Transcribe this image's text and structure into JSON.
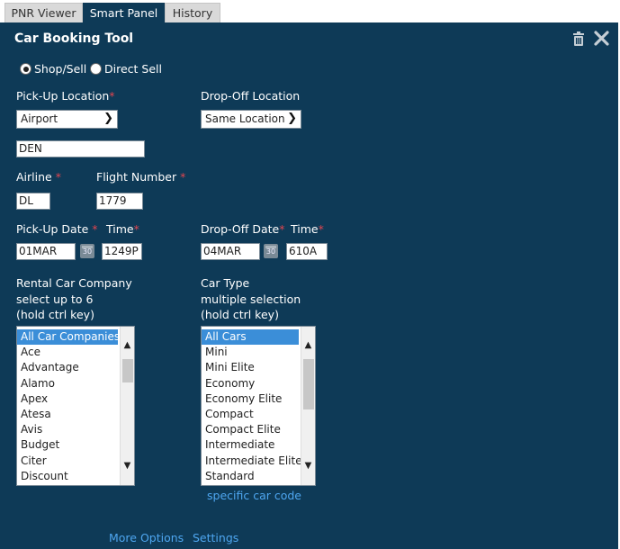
{
  "tabs": [
    {
      "label": "PNR Viewer",
      "active": false
    },
    {
      "label": "Smart Panel",
      "active": true
    },
    {
      "label": "History",
      "active": false
    }
  ],
  "panel": {
    "title": "Car Booking Tool",
    "icons": [
      "trash-icon",
      "close-icon"
    ]
  },
  "mode": {
    "options": [
      {
        "label": "Shop/Sell",
        "selected": true
      },
      {
        "label": "Direct Sell",
        "selected": false
      }
    ]
  },
  "pickup": {
    "label": "Pick-Up Location",
    "required_mark": "*",
    "select_value": "Airport",
    "code_value": "DEN"
  },
  "dropoff": {
    "label": "Drop-Off Location",
    "select_value": "Same Location"
  },
  "airline": {
    "label": "Airline",
    "required_mark": "*",
    "value": "DL"
  },
  "flight": {
    "label": "Flight Number",
    "required_mark": "*",
    "value": "1779"
  },
  "pickup_date": {
    "label": "Pick-Up Date",
    "required_mark": "*",
    "value": "01MAR",
    "time_label": "Time",
    "time_required_mark": "*",
    "time_value": "1249P",
    "calendar_glyph": "30"
  },
  "dropoff_date": {
    "label": "Drop-Off Date",
    "required_mark": "*",
    "value": "04MAR",
    "time_label": "Time",
    "time_required_mark": "*",
    "time_value": "610A",
    "calendar_glyph": "30"
  },
  "rental_company": {
    "label_lines": [
      "Rental Car Company",
      "select up to 6",
      "(hold ctrl key)"
    ],
    "options": [
      "All Car Companies",
      "Ace",
      "Advantage",
      "Alamo",
      "Apex",
      "Atesa",
      "Avis",
      "Budget",
      "Citer",
      "Discount"
    ],
    "selected_index": 0
  },
  "car_type": {
    "label_lines": [
      "Car Type",
      "multiple selection",
      "(hold ctrl key)"
    ],
    "options": [
      "All Cars",
      "Mini",
      "Mini Elite",
      "Economy",
      "Economy Elite",
      "Compact",
      "Compact Elite",
      "Intermediate",
      "Intermediate Elite",
      "Standard"
    ],
    "selected_index": 0,
    "link": "specific car code"
  },
  "footer": {
    "more_options": "More Options",
    "settings": "Settings"
  },
  "colors": {
    "panel_bg": "#0e3a57",
    "highlight": "#3b8ed8",
    "link": "#4ea6f0",
    "required": "#e0454f"
  }
}
